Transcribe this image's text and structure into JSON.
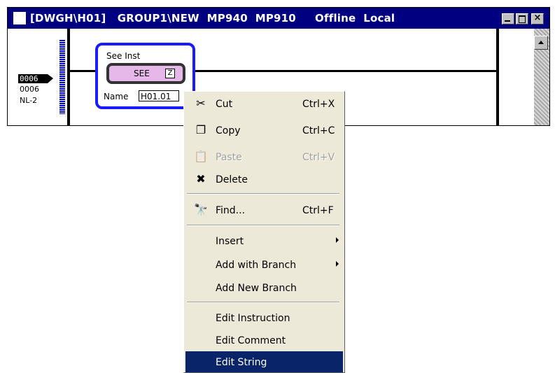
{
  "window": {
    "title": "[DWGH\\H01]   GROUP1\\NEW  MP940  MP910     Offline  Local",
    "close_glyph": "×"
  },
  "ladder": {
    "addresses": [
      "0006",
      "0006",
      "NL-2"
    ],
    "instruction": {
      "title": "See Inst",
      "mnemonic": "SEE",
      "glyph": "Z",
      "name_label": "Name",
      "name_value": "H01.01"
    }
  },
  "menu": {
    "items": [
      {
        "label": "Cut",
        "shortcut": "Ctrl+X",
        "icon": "scissors-icon",
        "glyph": "✂"
      },
      {
        "label": "Copy",
        "shortcut": "Ctrl+C",
        "icon": "copy-icon",
        "glyph": "❐"
      },
      {
        "label": "Paste",
        "shortcut": "Ctrl+V",
        "icon": "paste-icon",
        "glyph": "📋",
        "disabled": true
      },
      {
        "label": "Delete",
        "shortcut": "",
        "icon": "delete-x-icon",
        "glyph": "✖"
      },
      {
        "label": "Find...",
        "shortcut": "Ctrl+F",
        "icon": "binoculars-icon",
        "glyph": "🔭"
      },
      {
        "label": "Insert",
        "submenu": true
      },
      {
        "label": "Add with Branch",
        "submenu": true
      },
      {
        "label": "Add New Branch"
      },
      {
        "label": "Edit Instruction"
      },
      {
        "label": "Edit Comment"
      },
      {
        "label": "Edit String",
        "selected": true
      }
    ]
  },
  "colors": {
    "titlebar": "#000080",
    "selection": "#0a246a",
    "instruction_border": "#1a1aff",
    "instruction_fill": "#e6b8ea"
  }
}
